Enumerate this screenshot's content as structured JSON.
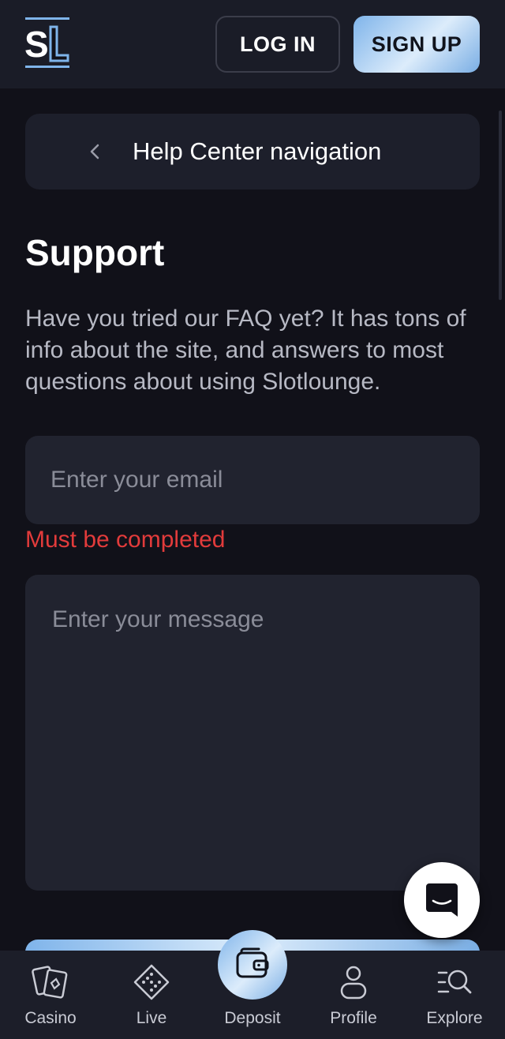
{
  "header": {
    "login_label": "LOG IN",
    "signup_label": "SIGN UP"
  },
  "help_nav": {
    "label": "Help Center navigation"
  },
  "support": {
    "title": "Support",
    "intro": "Have you tried our FAQ yet? It has tons of info about the site, and answers to most questions about using Slotlounge.",
    "email_placeholder": "Enter your email",
    "email_error": "Must be completed",
    "message_placeholder": "Enter your message"
  },
  "bottom_nav": {
    "items": [
      {
        "label": "Casino",
        "icon": "cards-icon"
      },
      {
        "label": "Live",
        "icon": "dice-icon"
      },
      {
        "label": "Deposit",
        "icon": "wallet-icon"
      },
      {
        "label": "Profile",
        "icon": "user-icon"
      },
      {
        "label": "Explore",
        "icon": "search-list-icon"
      }
    ]
  },
  "colors": {
    "background": "#111119",
    "header": "#1a1c27",
    "field": "#21232f",
    "accent": "#9cc6f0",
    "error": "#e23b3b"
  }
}
